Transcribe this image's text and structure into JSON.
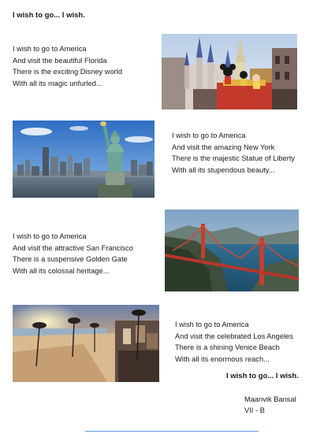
{
  "title": "I wish to go... I wish.",
  "stanzas": [
    {
      "lines": [
        "I wish to go to America",
        "And visit the beautiful Florida",
        "There is the exciting Disney world",
        "With all its magic unfurled..."
      ]
    },
    {
      "lines": [
        "I wish to go to America",
        "And visit the amazing New York",
        "There is the majestic Statue of Liberty",
        "With all its stupendous beauty..."
      ]
    },
    {
      "lines": [
        "I wish to go to America",
        "And visit the attractive San Francisco",
        "There is a suspensive Golden Gate",
        "With all its colossal heritage..."
      ]
    },
    {
      "lines": [
        "I wish to go to America",
        "And visit the celebrated Los Angeles",
        "There is a shining Venice Beach",
        "With all its enormous reach..."
      ]
    }
  ],
  "closing": "I wish to go... I wish.",
  "author": {
    "name": "Maanvik Bansal",
    "class": "VII - B"
  },
  "colors": {
    "text": "#1a1a1a",
    "rule": "#5b9bd5"
  }
}
